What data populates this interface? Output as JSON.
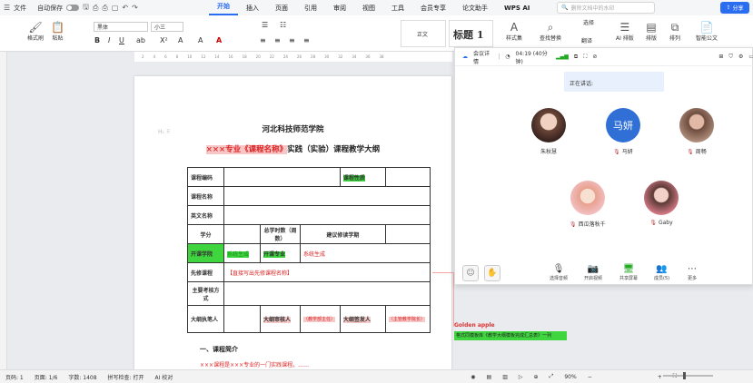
{
  "topbar": {
    "file": "文件",
    "autosave": "自动保存",
    "menu": [
      "开始",
      "插入",
      "页面",
      "引用",
      "审阅",
      "视图",
      "工具",
      "会员专享",
      "论文助手",
      "WPS AI"
    ],
    "active_menu": "开始",
    "search_placeholder": "删除文档中的水印",
    "share": "分享"
  },
  "ribbon": {
    "format_painter": "格式刷",
    "paste": "粘贴",
    "font_name": "黑体",
    "font_size": "小三",
    "style_normal": "正文",
    "style_heading": "标题 1",
    "style_set": "样式集",
    "find_replace": "查找替换",
    "translate": "翻译",
    "select": "选择",
    "ai_layout": "AI 排版",
    "layout": "排版",
    "arrange": "排列",
    "smart_doc": "智能公文"
  },
  "document": {
    "title": "河北科技师范学院",
    "subtitle_prefix": "×××专业《课程名称》",
    "subtitle_suffix": "实践（实验）课程教学大纲",
    "table": {
      "course_code": "课程编码",
      "course_nature": "课程性质",
      "course_name": "课程名称",
      "english_name": "英文名称",
      "credit": "学分",
      "total_hours": "总学时数（周数）",
      "suggested_term": "建议修读学期",
      "opening_college": "开课学院",
      "system_generated_1": "系统生成",
      "opening_major": "开课专业",
      "system_generated_2": "系统生成",
      "prerequisite": "先修课程",
      "prerequisite_value": "【直接写出先修课程名称】",
      "main_designers": "主要考核方式",
      "author": "大纲执笔人",
      "reviewer": "大纲审核人",
      "reviewer_value": "（教学部主任）",
      "approver": "大纲签发人",
      "approver_value": "（主管教学院长）"
    },
    "section_heading": "一、课程简介",
    "section_line": "×××课程是×××专业的一门实践课程。……"
  },
  "comment": {
    "author": "Golden apple",
    "text": "格式同模板库《教学大纲模板完成汇总表》一列"
  },
  "meeting": {
    "header_title": "会议详情",
    "timer": "04:19 (40分钟)",
    "speaking_label": "正在讲话:",
    "participants": [
      {
        "name": "朱秋慧",
        "muted": false
      },
      {
        "name": "马妍",
        "initials": "马妍",
        "muted": true
      },
      {
        "name": "周畅",
        "muted": true
      },
      {
        "name": "西瓜落秋千",
        "muted": true
      },
      {
        "name": "Gaby",
        "muted": true
      }
    ],
    "controls": {
      "mute": "选择音频",
      "video": "开启视频",
      "share_screen": "共享屏幕",
      "members": "成员(5)",
      "more": "更多"
    }
  },
  "statusbar": {
    "page_num": "页码: 1",
    "page_of": "页面: 1/6",
    "word_count": "字数: 1408",
    "spell_check": "拼写检查: 打开",
    "doc_check": "AI 校对",
    "zoom": "90%"
  },
  "colors": {
    "accent": "#2b6df0",
    "highlight_green": "#3fd53f",
    "highlight_pink": "#f7caca",
    "comment_red": "#dd3333"
  }
}
